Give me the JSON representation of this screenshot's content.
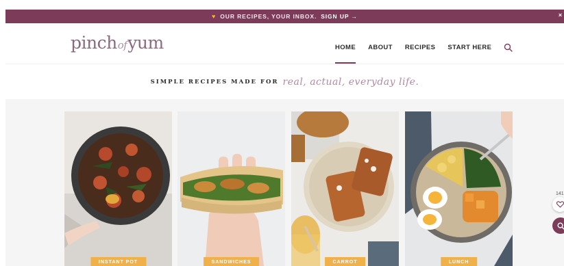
{
  "promo": {
    "text": "OUR RECIPES, YOUR INBOX.",
    "link": "SIGN UP →",
    "close": "×",
    "heart_icon": "heart-icon"
  },
  "header": {
    "logo_left": "pinch",
    "logo_mid": "of",
    "logo_right": "yum",
    "nav": [
      {
        "label": "HOME",
        "active": true
      },
      {
        "label": "ABOUT",
        "active": false
      },
      {
        "label": "RECIPES",
        "active": false
      },
      {
        "label": "START HERE",
        "active": false
      }
    ],
    "search_icon": "search-icon"
  },
  "tagline": {
    "static": "SIMPLE RECIPES MADE FOR",
    "script": "real, actual, everyday life."
  },
  "cards": [
    {
      "badge": "INSTANT POT"
    },
    {
      "badge": "SANDWICHES"
    },
    {
      "badge": "CARROT"
    },
    {
      "badge": "LUNCH"
    }
  ],
  "widgets": {
    "save_count": "141"
  },
  "colors": {
    "brand": "#7b3b59",
    "badge": "#f0b04a",
    "logo": "#8a6b7d"
  }
}
